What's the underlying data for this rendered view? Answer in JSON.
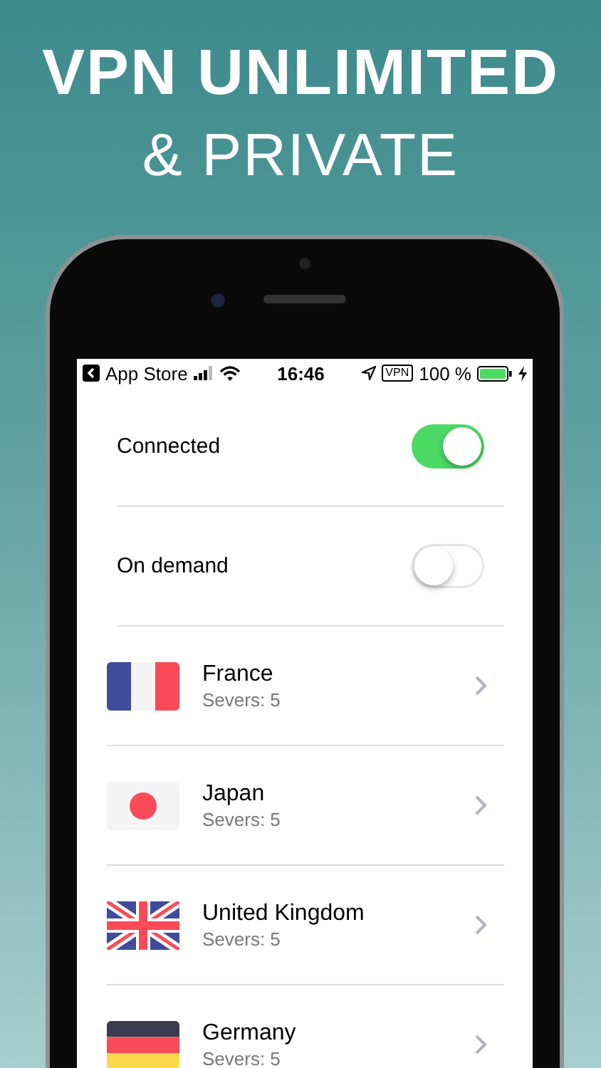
{
  "headline": {
    "line_1": "VPN UNLIMITED",
    "line_2": "& PRIVATE"
  },
  "status_bar": {
    "back_label": "App Store",
    "time": "16:46",
    "vpn_badge": "VPN",
    "battery": "100 %"
  },
  "settings": [
    {
      "label": "Connected",
      "on": true
    },
    {
      "label": "On demand",
      "on": false
    }
  ],
  "countries": [
    {
      "kind": "fr",
      "name": "France",
      "servers": "Severs: 5"
    },
    {
      "kind": "jp",
      "name": "Japan",
      "servers": "Severs: 5"
    },
    {
      "kind": "uk",
      "name": "United Kingdom",
      "servers": "Severs: 5"
    },
    {
      "kind": "de",
      "name": "Germany",
      "servers": "Severs: 5"
    }
  ]
}
